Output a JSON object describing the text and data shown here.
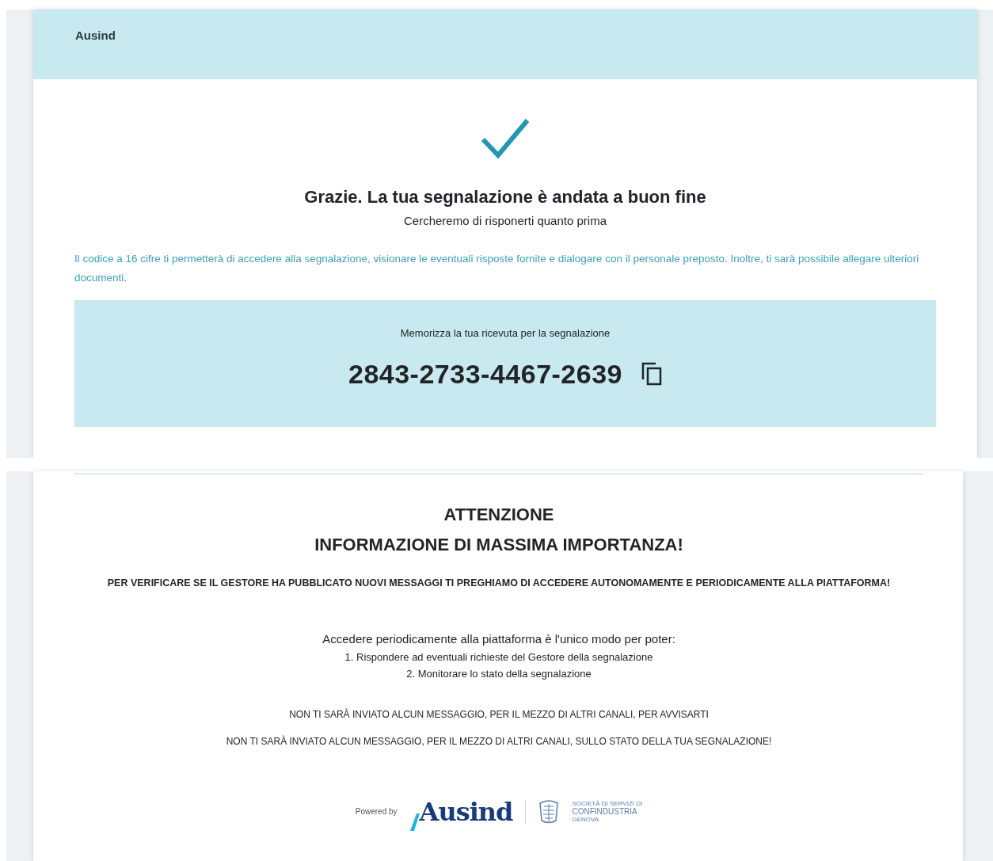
{
  "header": {
    "brand": "Ausind"
  },
  "confirmation": {
    "title": "Grazie. La tua segnalazione è andata a buon fine",
    "subtitle": "Cercheremo di risponerti quanto prima"
  },
  "info_text": "Il codice a 16 cifre ti permetterà di accedere alla segnalazione, visionare le eventuali risposte fornite e dialogare con il personale preposto. Inoltre, ti sarà possibile allegare ulteriori documenti.",
  "receipt": {
    "label": "Memorizza la tua ricevuta per la segnalazione",
    "code": "2843-2733-4467-2639"
  },
  "notice": {
    "headings": [
      "ATTENZIONE",
      "INFORMAZIONE DI MASSIMA IMPORTANZA!"
    ],
    "warning": "PER VERIFICARE SE IL GESTORE HA PUBBLICATO NUOVI MESSAGGI TI PREGHIAMO DI ACCEDERE AUTONOMAMENTE E PERIODICAMENTE ALLA PIATTAFORMA!",
    "intro": "Accedere periodicamente alla piattaforma è l'unico modo per poter:",
    "steps": [
      "1. Rispondere ad eventuali richieste del Gestore della segnalazione",
      "2. Monitorare lo stato della segnalazione"
    ],
    "disclaimers": [
      "NON TI SARÀ INVIATO ALCUN MESSAGGIO, PER IL MEZZO DI ALTRI CANALI, PER AVVISARTI",
      "NON TI SARÀ INVIATO ALCUN MESSAGGIO, PER IL MEZZO DI ALTRI CANALI, SULLO STATO DELLA TUA SEGNALAZIONE!"
    ]
  },
  "footer": {
    "powered_by": "Powered by",
    "logo_text": "Ausind",
    "partner_lines": [
      "SOCIETÀ DI SERVIZI DI",
      "CONFINDUSTRIA",
      "GENOVA"
    ]
  }
}
